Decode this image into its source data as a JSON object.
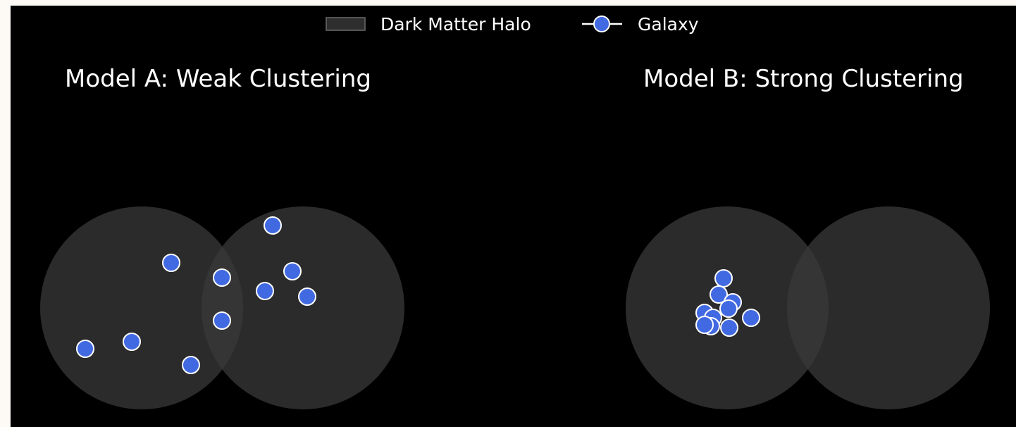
{
  "legend": {
    "halo_label": "Dark Matter Halo",
    "galaxy_label": "Galaxy"
  },
  "colors": {
    "background": "#000000",
    "halo_fill": "#3a3a3a",
    "galaxy_fill": "#4169e1",
    "galaxy_edge": "#ffffff",
    "text": "#ffffff"
  },
  "panels": [
    {
      "title": "Model A: Weak Clustering",
      "halo_count": 2,
      "galaxy_count": 10
    },
    {
      "title": "Model B: Strong Clustering",
      "halo_count": 2,
      "galaxy_count": 10
    }
  ]
}
